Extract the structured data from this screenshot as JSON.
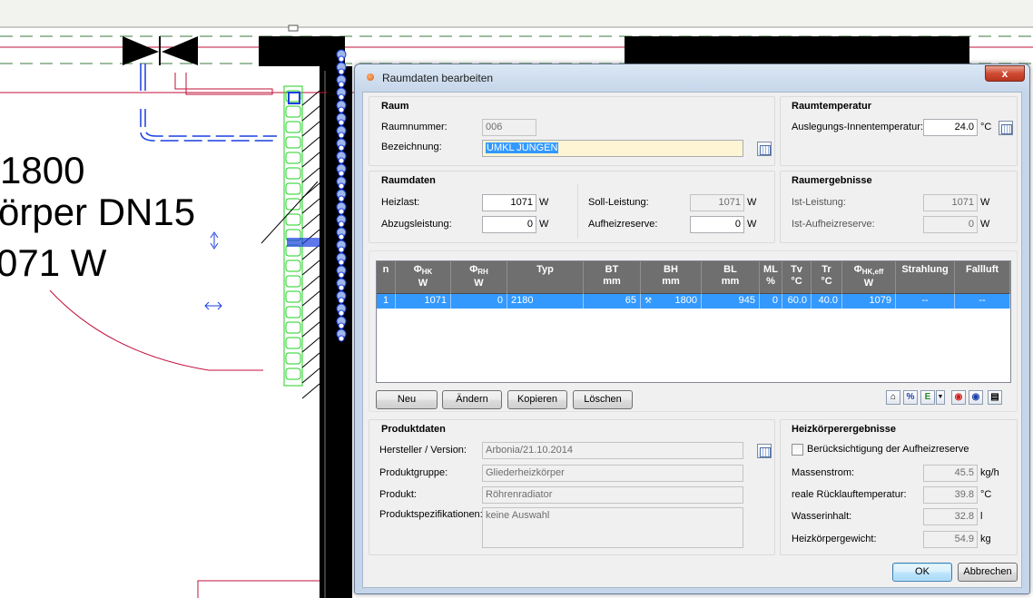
{
  "background": {
    "line1": "1800",
    "line2": "örper DN15",
    "line3": "071 W"
  },
  "dialog": {
    "title": "Raumdaten bearbeiten",
    "close_label": "x"
  },
  "raum": {
    "title": "Raum",
    "nummer_label": "Raumnummer:",
    "nummer_value": "006",
    "bezeichnung_label": "Bezeichnung:",
    "bezeichnung_value": "UMKL JUNGEN"
  },
  "raumtemperatur": {
    "title": "Raumtemperatur",
    "label": "Auslegungs-Innentemperatur:",
    "value": "24.0",
    "unit": "°C"
  },
  "raumdaten": {
    "title": "Raumdaten",
    "heizlast_label": "Heizlast:",
    "heizlast_value": "1071",
    "heizlast_unit": "W",
    "abzug_label": "Abzugsleistung:",
    "abzug_value": "0",
    "abzug_unit": "W",
    "soll_label": "Soll-Leistung:",
    "soll_value": "1071",
    "soll_unit": "W",
    "aufheiz_label": "Aufheizreserve:",
    "aufheiz_value": "0",
    "aufheiz_unit": "W"
  },
  "raumergebnisse": {
    "title": "Raumergebnisse",
    "ist_label": "Ist-Leistung:",
    "ist_value": "1071",
    "ist_unit": "W",
    "istauf_label": "Ist-Aufheizreserve:",
    "istauf_value": "0",
    "istauf_unit": "W"
  },
  "table": {
    "headers": [
      {
        "main": "n",
        "sub": "",
        "unit": ""
      },
      {
        "main": "Φ",
        "sub": "HK",
        "unit": "W"
      },
      {
        "main": "Φ",
        "sub": "RH",
        "unit": "W"
      },
      {
        "main": "Typ",
        "sub": "",
        "unit": ""
      },
      {
        "main": "BT",
        "sub": "",
        "unit": "mm"
      },
      {
        "main": "BH",
        "sub": "",
        "unit": "mm"
      },
      {
        "main": "BL",
        "sub": "",
        "unit": "mm"
      },
      {
        "main": "ML",
        "sub": "",
        "unit": "%"
      },
      {
        "main": "Tv",
        "sub": "",
        "unit": "°C"
      },
      {
        "main": "Tr",
        "sub": "",
        "unit": "°C"
      },
      {
        "main": "Φ",
        "sub": "HK,eff",
        "unit": "W"
      },
      {
        "main": "Strahlung",
        "sub": "",
        "unit": ""
      },
      {
        "main": "Fallluft",
        "sub": "",
        "unit": ""
      }
    ],
    "row": [
      "1",
      "1071",
      "0",
      "2180",
      "65",
      "1800",
      "945",
      "0",
      "60.0",
      "40.0",
      "1079",
      "--",
      "--"
    ]
  },
  "buttons": {
    "neu": "Neu",
    "aendern": "Ändern",
    "kopieren": "Kopieren",
    "loeschen": "Löschen",
    "ok": "OK",
    "abbrechen": "Abbrechen"
  },
  "toolbar_icons": {
    "pct": "%",
    "e": "E"
  },
  "produktdaten": {
    "title": "Produktdaten",
    "hersteller_label": "Hersteller / Version:",
    "hersteller_value": "Arbonia/21.10.2014",
    "gruppe_label": "Produktgruppe:",
    "gruppe_value": "Gliederheizkörper",
    "produkt_label": "Produkt:",
    "produkt_value": "Röhrenradiator",
    "spez_label": "Produktspezifikationen:",
    "spez_value": "keine Auswahl"
  },
  "hkergebnisse": {
    "title": "Heizkörperergebnisse",
    "checkbox_label": "Berücksichtigung der Aufheizreserve",
    "massenstrom_label": "Massenstrom:",
    "massenstrom_value": "45.5",
    "massenstrom_unit": "kg/h",
    "ruecklauf_label": "reale Rücklauftemperatur:",
    "ruecklauf_value": "39.8",
    "ruecklauf_unit": "°C",
    "wasser_label": "Wasserinhalt:",
    "wasser_value": "32.8",
    "wasser_unit": "l",
    "gewicht_label": "Heizkörpergewicht:",
    "gewicht_value": "54.9",
    "gewicht_unit": "kg"
  }
}
